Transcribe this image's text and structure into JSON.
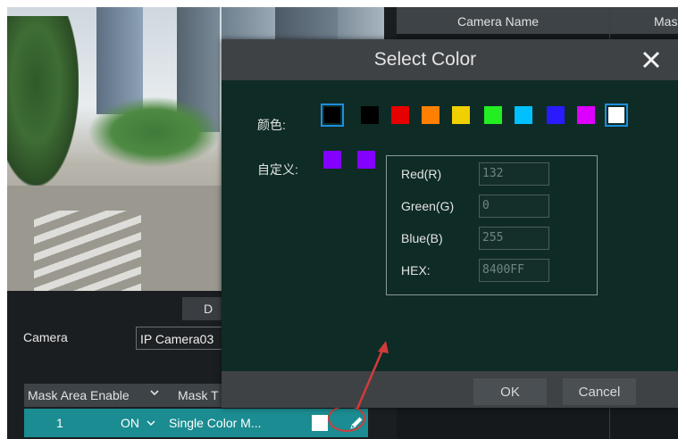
{
  "dialog": {
    "title": "Select Color",
    "color_label": "颜色:",
    "custom_label": "自定义:",
    "palette": [
      "#000000",
      "#000000",
      "#e60000",
      "#ff7f00",
      "#f0d000",
      "#22ee22",
      "#00c0ff",
      "#2a1bff",
      "#dd00ff",
      "#ffffff"
    ],
    "selected_palette_index": 9,
    "custom_colors": [
      "#8400ff",
      "#8400ff"
    ],
    "fields": {
      "red_label": "Red(R)",
      "red_value": "132",
      "green_label": "Green(G)",
      "green_value": "0",
      "blue_label": "Blue(B)",
      "blue_value": "255",
      "hex_label": "HEX:",
      "hex_value": "8400FF"
    },
    "ok_label": "OK",
    "cancel_label": "Cancel"
  },
  "camera": {
    "d_button_label": "D",
    "label": "Camera",
    "value": "IP Camera03"
  },
  "mask_table": {
    "header_area_enable": "Mask Area Enable",
    "header_chevron": "⌄",
    "header_mask": "Mask T",
    "row": {
      "number": "1",
      "enable": "ON",
      "enable_chevron": "⌄",
      "type": "Single Color M...",
      "swatch_color": "#ffffff"
    }
  },
  "right_table": {
    "header_camera_name": "Camera Name",
    "header_mask": "Mas"
  },
  "accent_colors": {
    "row_highlight": "#1b8c91",
    "selection_border": "#1d8fe0",
    "annotation": "#d23b3b"
  }
}
